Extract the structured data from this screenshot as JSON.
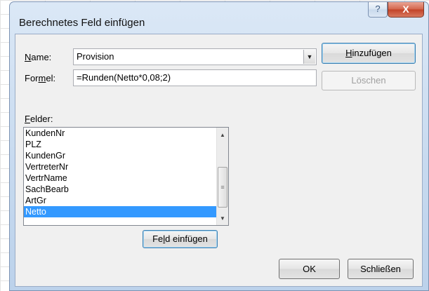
{
  "dialog": {
    "title": "Berechnetes Feld einfügen",
    "help_icon": "?",
    "close_icon": "X"
  },
  "name": {
    "label_pre": "",
    "label_ul": "N",
    "label_post": "ame:",
    "value": "Provision"
  },
  "formel": {
    "label_pre": "For",
    "label_ul": "m",
    "label_post": "el:",
    "value": "=Runden(Netto*0,08;2)"
  },
  "buttons": {
    "add_pre": "",
    "add_ul": "H",
    "add_post": "inzufügen",
    "delete": "Löschen",
    "insert_pre": "Fe",
    "insert_ul": "l",
    "insert_post": "d einfügen",
    "ok": "OK",
    "close": "Schließen"
  },
  "fields": {
    "label_pre": "",
    "label_ul": "F",
    "label_post": "elder:",
    "items": [
      "KundenNr",
      "PLZ",
      "KundenGr",
      "VertreterNr",
      "VertrName",
      "SachBearb",
      "ArtGr",
      "Netto"
    ],
    "selected": "Netto"
  },
  "colors": {
    "selection": "#3399ff",
    "close_button": "#c24227",
    "title_bar": "#c6d9ef"
  }
}
